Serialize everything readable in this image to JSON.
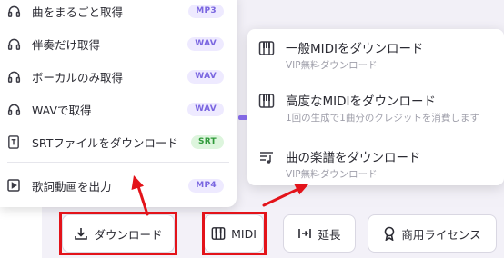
{
  "download_menu": {
    "items": [
      {
        "icon": "headphones-icon",
        "label": "曲をまるごと取得",
        "badge": "MP3",
        "badge_color": "#7a66e0"
      },
      {
        "icon": "headphones-icon",
        "label": "伴奏だけ取得",
        "badge": "WAV",
        "badge_color": "#7a66e0"
      },
      {
        "icon": "headphones-icon",
        "label": "ボーカルのみ取得",
        "badge": "WAV",
        "badge_color": "#7a66e0"
      },
      {
        "icon": "headphones-icon",
        "label": "WAVで取得",
        "badge": "WAV",
        "badge_color": "#7a66e0"
      },
      {
        "icon": "subtitle-file-icon",
        "label": "SRTファイルをダウンロード",
        "badge": "SRT",
        "badge_color": "#2f9a3a"
      },
      {
        "icon": "video-play-icon",
        "label": "歌詞動画を出力",
        "badge": "MP4",
        "badge_color": "#7a66e0"
      }
    ]
  },
  "midi_menu": {
    "items": [
      {
        "icon": "piano-icon",
        "title": "一般MIDIをダウンロード",
        "subtitle": "VIP無料ダウンロード"
      },
      {
        "icon": "piano-icon",
        "title": "高度なMIDIをダウンロード",
        "subtitle": "1回の生成で1曲分のクレジットを消費します"
      },
      {
        "icon": "music-score-icon",
        "title": "曲の楽譜をダウンロード",
        "subtitle": "VIP無料ダウンロード"
      }
    ]
  },
  "toolbar": {
    "download_label": "ダウンロード",
    "midi_label": "MIDI",
    "extend_label": "延長",
    "license_label": "商用ライセンス"
  },
  "annotation": {
    "highlight_color": "#e3131a"
  }
}
